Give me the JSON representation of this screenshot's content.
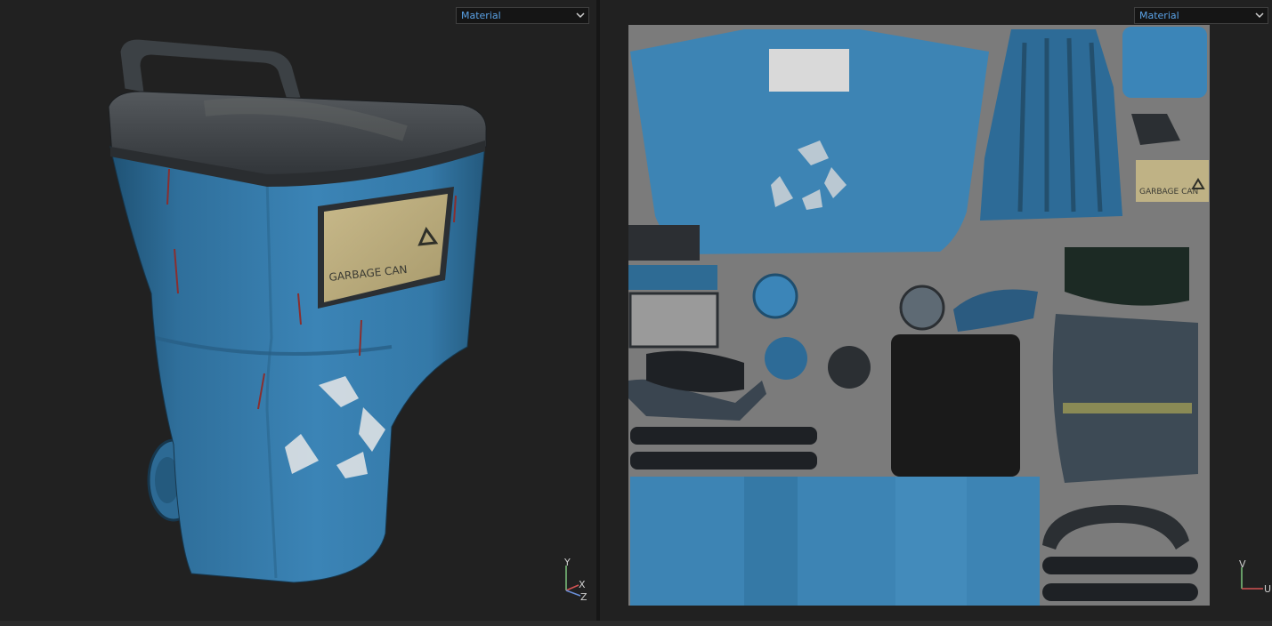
{
  "viewport_3d": {
    "material_dropdown": {
      "selected": "Material"
    },
    "model": {
      "label_text": "GARBAGE CAN",
      "recycle_icon": "recycle-icon"
    },
    "axis_gizmo": {
      "y_label": "Y",
      "x_label": "X",
      "z_label": "Z"
    }
  },
  "viewport_2d": {
    "material_dropdown": {
      "selected": "Material"
    },
    "uv_sheet": {
      "label_text": "GARBAGE CAN",
      "recycle_icon": "recycle-icon"
    },
    "axis_gizmo": {
      "v_label": "V",
      "u_label": "U"
    }
  },
  "colors": {
    "background": "#212121",
    "can_blue": "#3a7fae",
    "lid_dark": "#3a4045",
    "uv_background": "#7b7b7b",
    "accent": "#5aa2e6"
  }
}
